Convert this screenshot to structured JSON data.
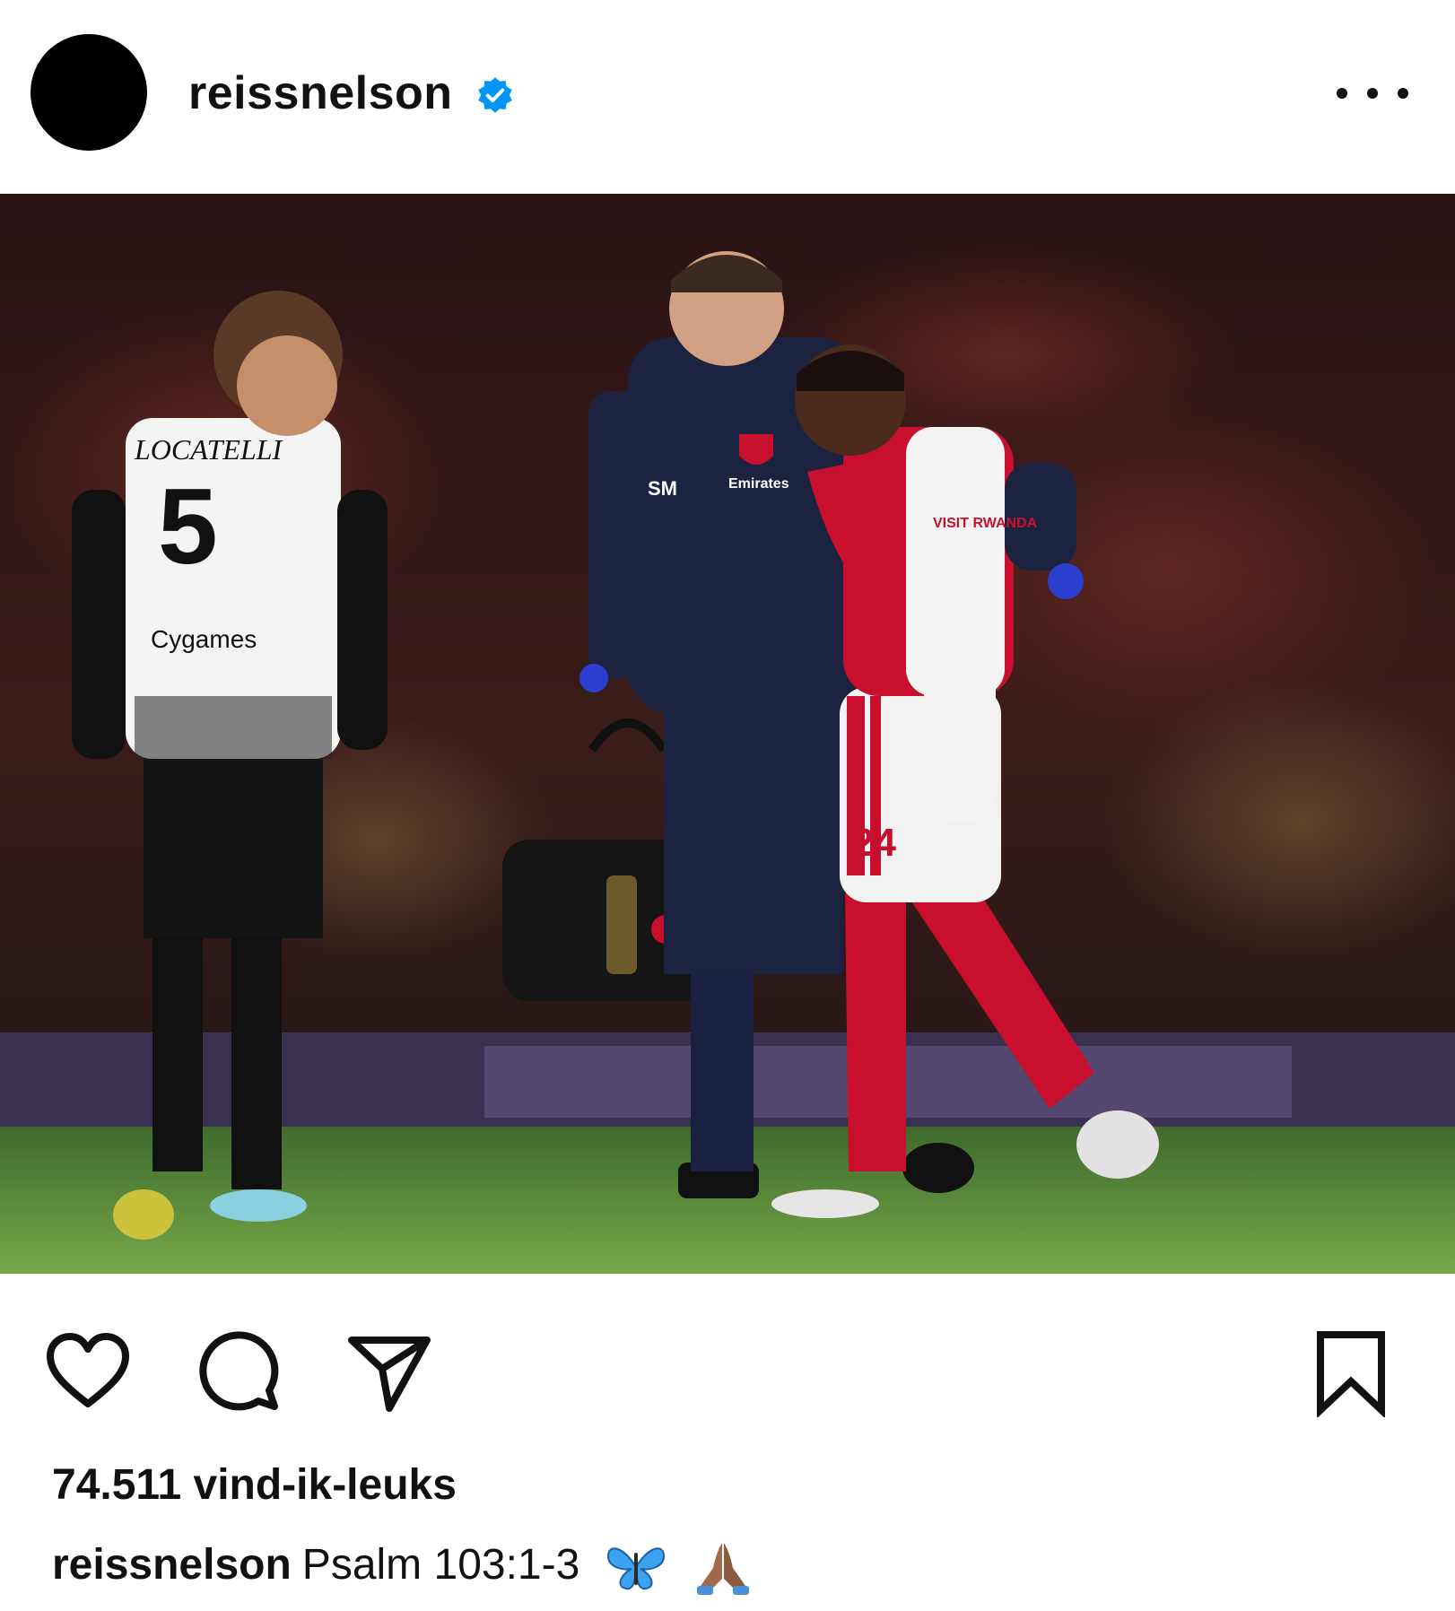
{
  "post": {
    "username": "reissnelson",
    "verified": true,
    "likes_text": "74.511 vind-ik-leuks",
    "caption": {
      "username": "reissnelson",
      "text": "Psalm 103:1-3",
      "emojis": [
        "butterfly-emoji",
        "folded-hands-emoji"
      ]
    }
  },
  "photo": {
    "jersey_texts": {
      "juventus_name": "LOCATELLI",
      "juventus_number": "5",
      "juventus_sponsor": "Cygames",
      "staff_initials": "SM",
      "staff_sponsor": "Emirates",
      "arsenal_sleeve": "VISIT RWANDA",
      "arsenal_number": "24"
    }
  },
  "icons": {
    "like": "heart-icon",
    "comment": "comment-icon",
    "share": "paper-plane-icon",
    "save": "bookmark-icon",
    "more": "more-dots-icon",
    "verified": "verified-badge-icon"
  },
  "colors": {
    "verified_blue": "#0095f6",
    "arsenal_red": "#c8102e",
    "staff_navy": "#1c2340"
  }
}
